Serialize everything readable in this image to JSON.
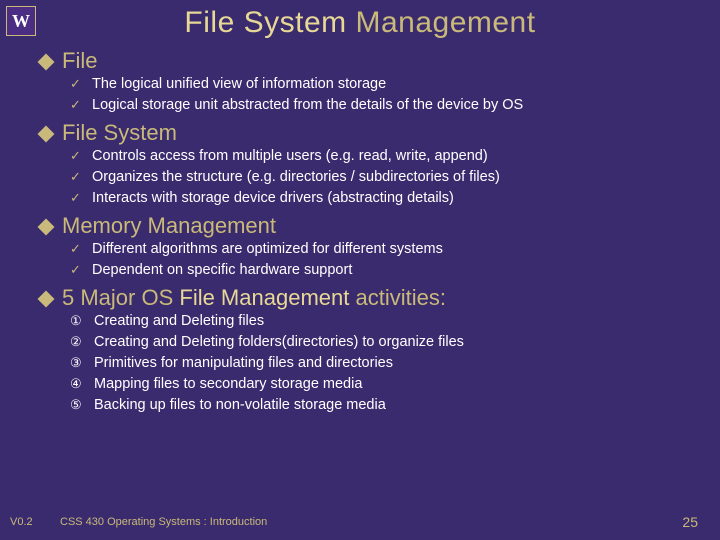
{
  "logo_letter": "W",
  "title_prefix": "File System",
  "title_suffix": " Management",
  "sections": [
    {
      "heading_prefix": "",
      "heading_suffix": "File",
      "bullet_style": "check",
      "items": [
        "The logical unified view of information storage",
        "Logical storage unit abstracted from the details of the device by OS"
      ]
    },
    {
      "heading_prefix": "",
      "heading_suffix": "File System",
      "bullet_style": "check",
      "items": [
        "Controls access from multiple users (e.g. read, write, append)",
        "Organizes the structure (e.g. directories / subdirectories of files)",
        "Interacts with storage device drivers (abstracting details)"
      ]
    },
    {
      "heading_prefix": "",
      "heading_suffix": "Memory Management",
      "bullet_style": "check",
      "items": [
        "Different algorithms are optimized for different systems",
        "Dependent on specific hardware support"
      ]
    },
    {
      "heading_prefix": "5 Major OS ",
      "heading_fm": "File Management",
      "heading_suffix": " activities:",
      "bullet_style": "number",
      "items": [
        "Creating and Deleting files",
        "Creating and Deleting folders(directories) to organize files",
        "Primitives for manipulating files and directories",
        "Mapping files to secondary storage media",
        "Backing up files to non-volatile storage media"
      ]
    }
  ],
  "footer": {
    "version": "V0.2",
    "course": "CSS 430 Operating Systems : Introduction",
    "page": "25"
  },
  "glyphs": {
    "check": "✓",
    "numbers": [
      "①",
      "②",
      "③",
      "④",
      "⑤"
    ]
  }
}
